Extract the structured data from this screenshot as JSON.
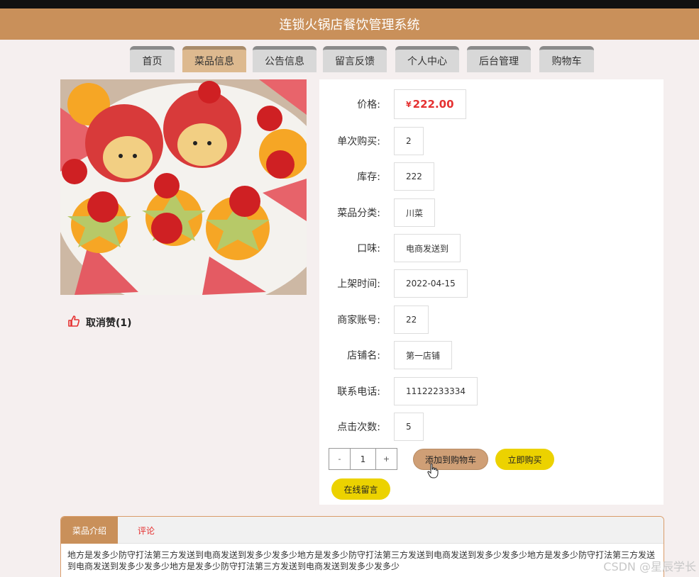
{
  "app": {
    "title": "连锁火锅店餐饮管理系统"
  },
  "nav": {
    "items": [
      {
        "label": "首页"
      },
      {
        "label": "菜品信息"
      },
      {
        "label": "公告信息"
      },
      {
        "label": "留言反馈"
      },
      {
        "label": "个人中心"
      },
      {
        "label": "后台管理"
      },
      {
        "label": "购物车"
      }
    ],
    "active": "菜品信息"
  },
  "like": {
    "label": "取消赞(1)",
    "icon": "thumbs-up-icon"
  },
  "details": {
    "price": {
      "label": "价格:",
      "currency": "¥",
      "value": "222.00"
    },
    "fields": [
      {
        "label": "单次购买:",
        "value": "2"
      },
      {
        "label": "库存:",
        "value": "222"
      },
      {
        "label": "菜品分类:",
        "value": "川菜"
      },
      {
        "label": "口味:",
        "value": "电商发送到"
      },
      {
        "label": "上架时间:",
        "value": "2022-04-15"
      },
      {
        "label": "商家账号:",
        "value": "22"
      },
      {
        "label": "店铺名:",
        "value": "第一店铺"
      },
      {
        "label": "联系电话:",
        "value": "11122233334"
      },
      {
        "label": "点击次数:",
        "value": "5"
      }
    ]
  },
  "quantity": {
    "minus": "-",
    "value": "1",
    "plus": "+"
  },
  "actions": {
    "add_to_cart": "添加到购物车",
    "buy_now": "立即购买",
    "leave_message": "在线留言"
  },
  "tabs": {
    "items": [
      {
        "label": "菜品介绍"
      },
      {
        "label": "评论"
      }
    ],
    "active": "菜品介绍",
    "content": "地方是发多少防守打法第三方发送到电商发送到发多少发多少地方是发多少防守打法第三方发送到电商发送到发多少发多少地方是发多少防守打法第三方发送到电商发送到发多少发多少地方是发多少防守打法第三方发送到电商发送到发多少发多少"
  },
  "watermark": "CSDN @星辰学长",
  "colors": {
    "header": "#c9905a",
    "active_tab": "#ddb98f",
    "price": "#e53030",
    "buy_button": "#ecd200",
    "cart_button": "#cf9f76"
  }
}
